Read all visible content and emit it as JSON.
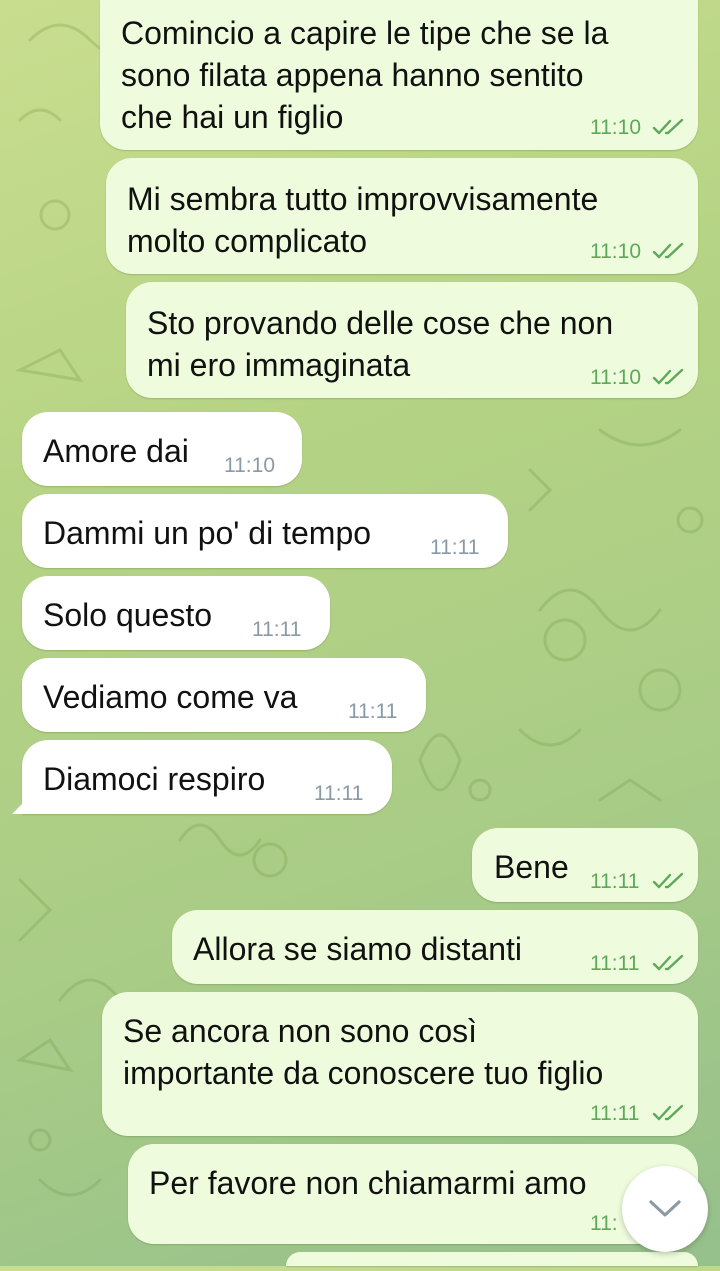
{
  "messages": [
    {
      "direction": "out",
      "text": "Comincio a capire le tipe che se la\nsono filata appena hanno sentito\nche hai un figlio",
      "time": "11:10"
    },
    {
      "direction": "out",
      "text": "Mi sembra tutto improvvisamente\nmolto complicato",
      "time": "11:10"
    },
    {
      "direction": "out",
      "text": "Sto provando delle cose che non\nmi ero immaginata",
      "time": "11:10"
    },
    {
      "direction": "in",
      "text": "Amore dai",
      "time": "11:10"
    },
    {
      "direction": "in",
      "text": "Dammi un po' di tempo",
      "time": "11:11"
    },
    {
      "direction": "in",
      "text": "Solo questo",
      "time": "11:11"
    },
    {
      "direction": "in",
      "text": "Vediamo come va",
      "time": "11:11"
    },
    {
      "direction": "in",
      "text": "Diamoci respiro",
      "time": "11:11"
    },
    {
      "direction": "out",
      "text": "Bene",
      "time": "11:11"
    },
    {
      "direction": "out",
      "text": "Allora se siamo distanti",
      "time": "11:11"
    },
    {
      "direction": "out",
      "text": "Se ancora non sono così\nimportante da conoscere tuo figlio",
      "time": "11:11"
    },
    {
      "direction": "out",
      "text": "Per favore non chiamarmi amo",
      "time": "11:"
    }
  ],
  "ui": {
    "scroll_button_icon": "chevron-down-icon",
    "read_receipt_icon": "double-check-icon",
    "colors": {
      "outgoing_bubble": "#eefcdd",
      "incoming_bubble": "#ffffff",
      "outgoing_time": "#5da95a",
      "incoming_time": "#8a9aa6"
    }
  }
}
